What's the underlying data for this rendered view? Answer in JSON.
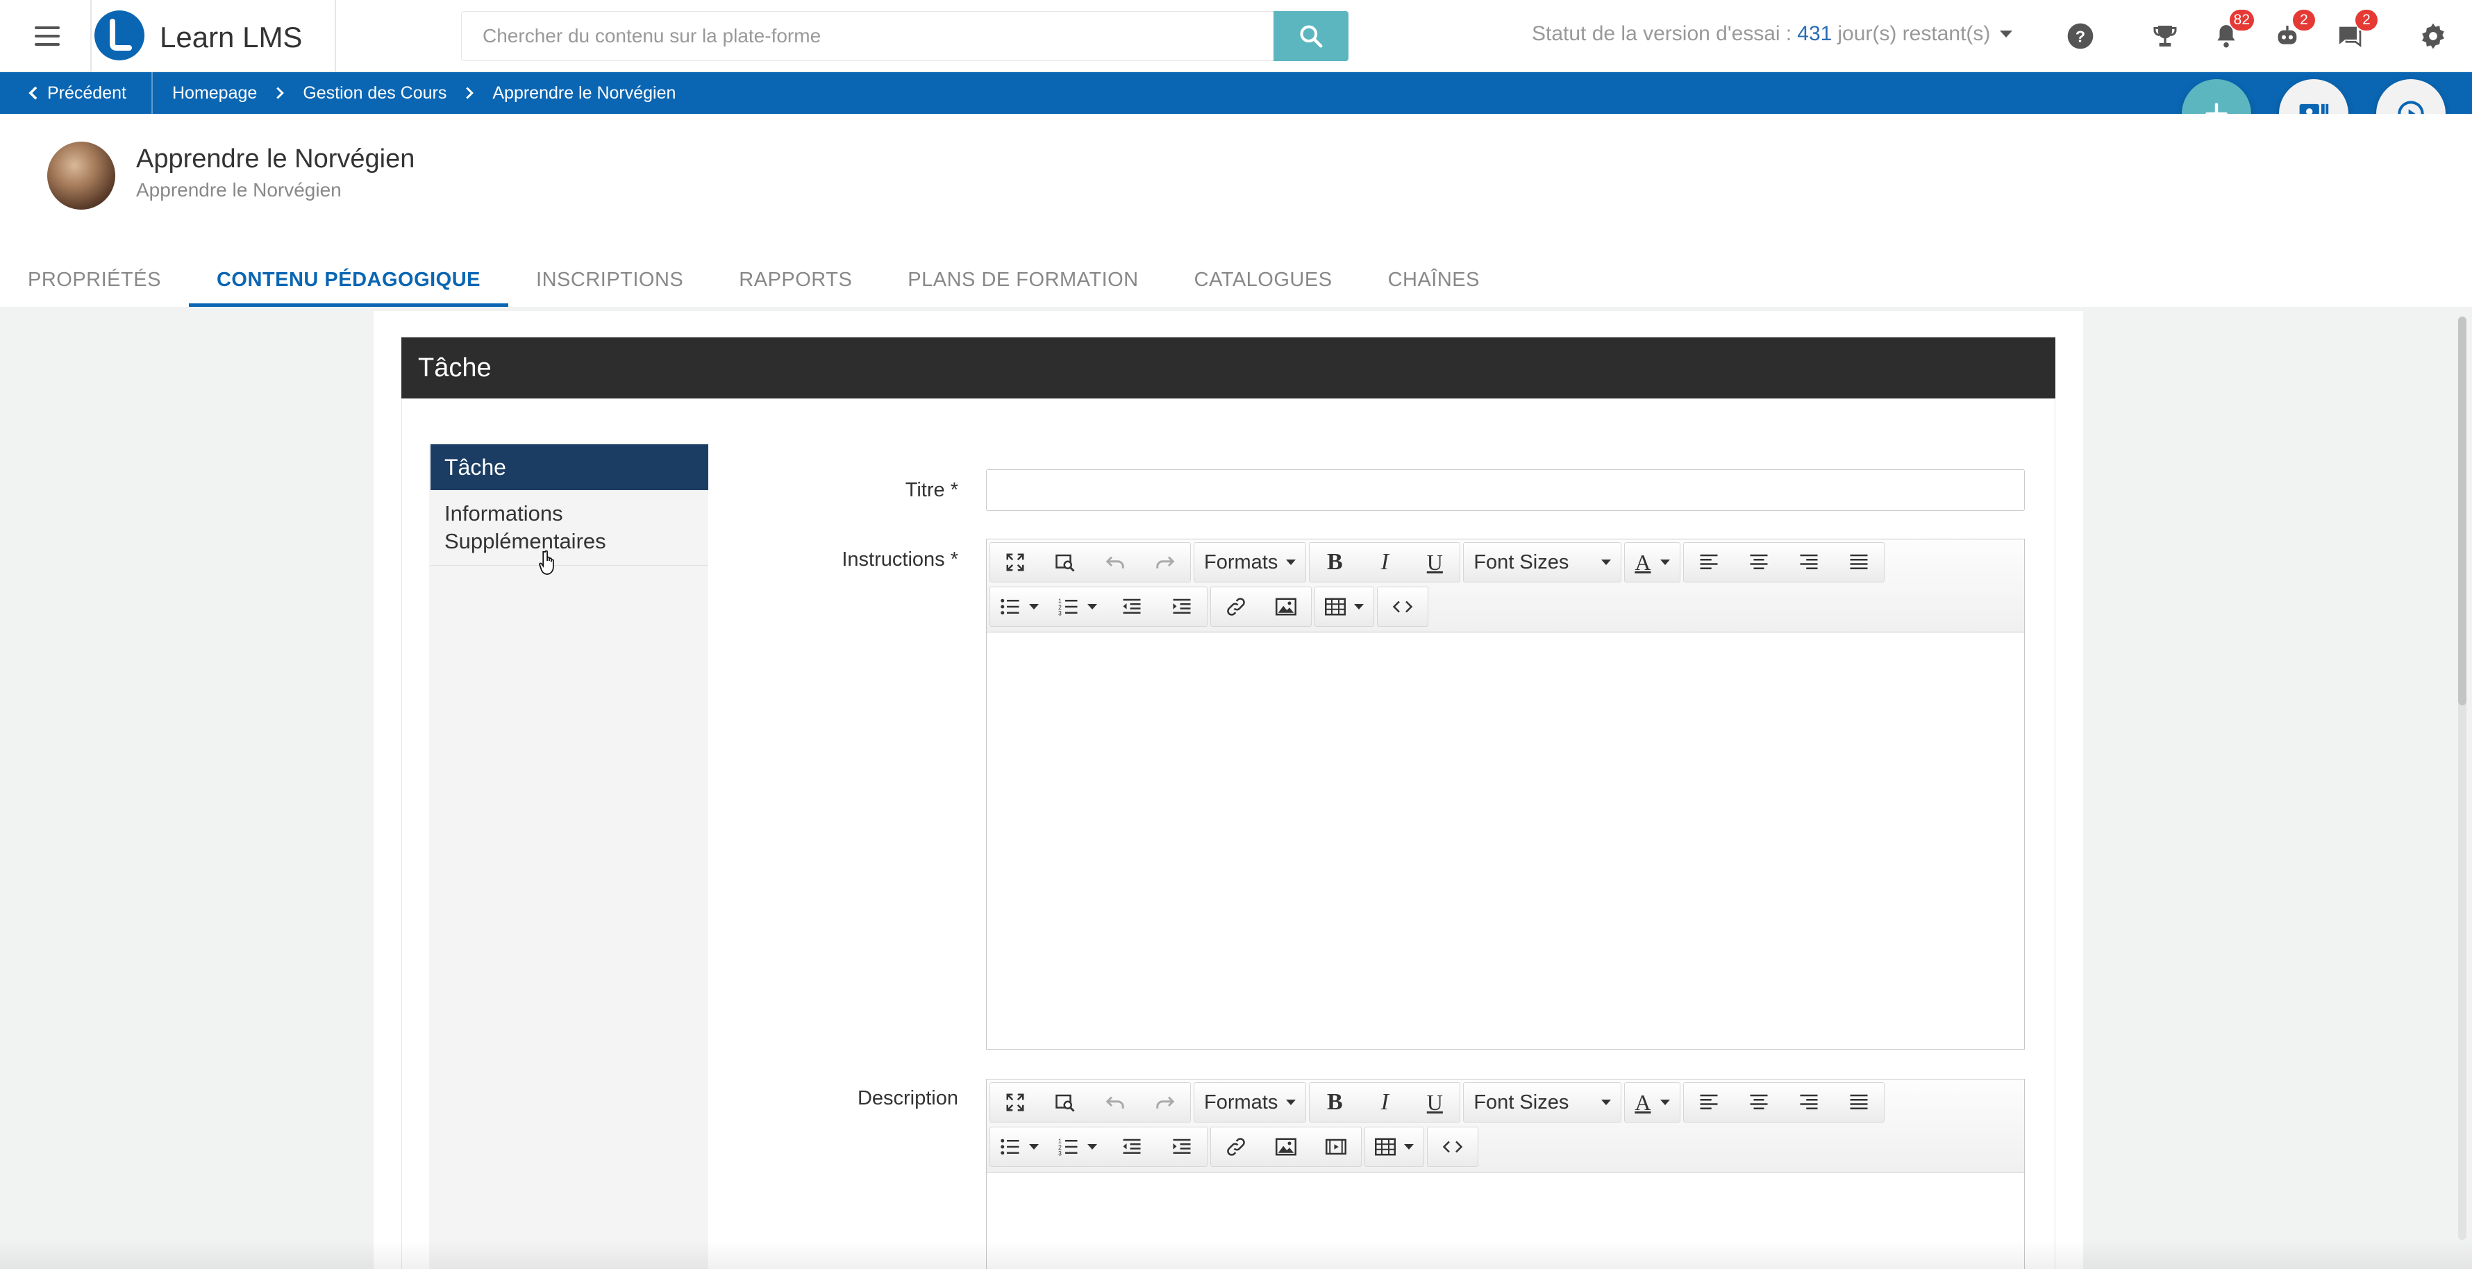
{
  "header": {
    "brand": "Learn LMS",
    "search_placeholder": "Chercher du contenu sur la plate-forme",
    "trial_label": "Statut de la version d'essai :",
    "trial_days": "431",
    "trial_suffix": "jour(s) restant(s)",
    "badges": {
      "notifications": "82",
      "robot": "2",
      "messages": "2"
    }
  },
  "breadcrumb": {
    "back_label": "Précédent",
    "items": [
      "Homepage",
      "Gestion des Cours",
      "Apprendre le Norvégien"
    ]
  },
  "course": {
    "title": "Apprendre le Norvégien",
    "subtitle": "Apprendre le Norvégien"
  },
  "tabs": [
    {
      "label": "PROPRIÉTÉS",
      "active": false
    },
    {
      "label": "CONTENU PÉDAGOGIQUE",
      "active": true
    },
    {
      "label": "INSCRIPTIONS",
      "active": false
    },
    {
      "label": "RAPPORTS",
      "active": false
    },
    {
      "label": "PLANS DE FORMATION",
      "active": false
    },
    {
      "label": "CATALOGUES",
      "active": false
    },
    {
      "label": "CHAÎNES",
      "active": false
    }
  ],
  "panel": {
    "title": "Tâche",
    "side_items": [
      "Tâche",
      "Informations Supplémentaires"
    ],
    "fields": {
      "titre_label": "Titre *",
      "titre_value": "",
      "instructions_label": "Instructions *",
      "description_label": "Description"
    },
    "toolbar": {
      "formats": "Formats",
      "font_sizes": "Font Sizes",
      "bold": "B",
      "italic": "I",
      "underline": "U",
      "text_color": "A"
    }
  },
  "colors": {
    "brand_blue": "#0a66b3",
    "teal": "#5bb6c0",
    "panel_header": "#2d2d2d",
    "side_active": "#1c3d63",
    "badge_red": "#e53935"
  }
}
